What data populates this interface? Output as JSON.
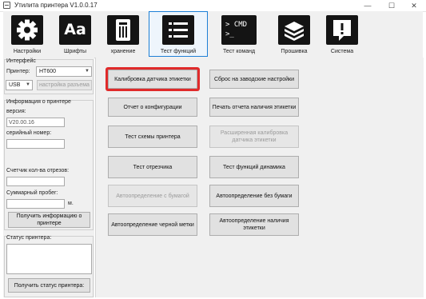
{
  "window": {
    "title": "Утилита принтера  V1.0.0.17",
    "min": "—",
    "max": "☐",
    "close": "✕"
  },
  "toolbar": [
    {
      "label": "Настройки",
      "icon": "gear-icon"
    },
    {
      "label": "Шрифты",
      "icon": "font-icon",
      "glyph": "Aa"
    },
    {
      "label": "хранение",
      "icon": "storage-icon"
    },
    {
      "label": "Тест функций",
      "icon": "list-icon",
      "active": true
    },
    {
      "label": "Тест команд",
      "icon": "terminal-icon",
      "glyph1": "> CMD",
      "glyph2": ">_"
    },
    {
      "label": "Прошивка",
      "icon": "chip-icon"
    },
    {
      "label": "Система",
      "icon": "alert-icon",
      "glyph": "!"
    }
  ],
  "left": {
    "interface_title": "Интерфейс",
    "printer_label": "Принтер:",
    "printer_value": "HT600",
    "port_value": "USB",
    "port_settings_button": "настройка разъема",
    "info_title": "Информация о принтере",
    "version_label": "версия:",
    "version_value": "V20.00.16",
    "serial_label": "серийный номер:",
    "serial_value": "",
    "cut_counter_label": "Счетчик кол-ва отрезов:",
    "cut_counter_value": "",
    "mileage_label": "Суммарный пробег:",
    "mileage_value": "",
    "mileage_unit": "м.",
    "get_info_button": "Получить информацию о принтере",
    "status_title": "Статус принтера:",
    "status_value": "",
    "get_status_button": "Получить статус принтера:"
  },
  "buttons": {
    "calibrate_label_sensor": "Калибровка датчика этикетки",
    "factory_reset": "Сброс на заводские настройки",
    "config_report": "Отчет о конфигурации",
    "print_label_presence_report": "Печать отчета наличия этикетки",
    "print_scheme_test": "Тест схемы принтера",
    "extended_calibration": "Расширенная калибровка датчика этикетки",
    "cutter_test": "Тест отрезчика",
    "speaker_test": "Тест функций динамика",
    "autodetect_paper": "Автоопределение с бумагой",
    "autodetect_no_paper": "Автоопределение без бумаги",
    "autodetect_black_mark": "Автоопределение черной метки",
    "autodetect_label_presence": "Автоопределение наличия этикетки"
  }
}
